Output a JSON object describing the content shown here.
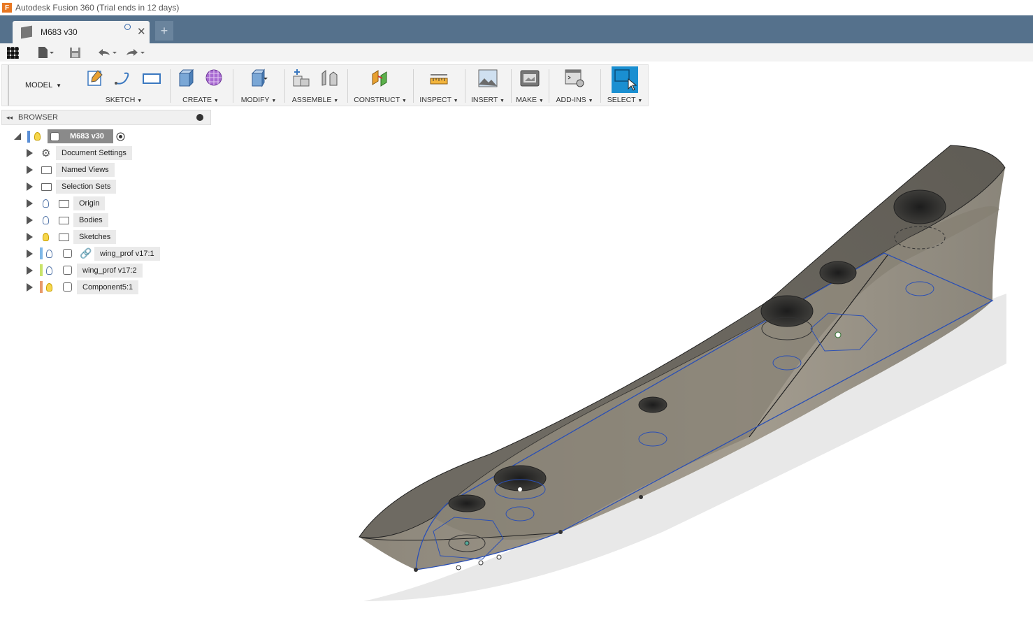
{
  "window": {
    "title": "Autodesk Fusion 360 (Trial ends in 12 days)",
    "app_icon": "F"
  },
  "tabs": {
    "doc_title": "M683 v30",
    "new_tab": "+",
    "close": "✕"
  },
  "toolbar": {
    "workspace": "MODEL",
    "groups": [
      {
        "label": "SKETCH"
      },
      {
        "label": "CREATE"
      },
      {
        "label": "MODIFY"
      },
      {
        "label": "ASSEMBLE"
      },
      {
        "label": "CONSTRUCT"
      },
      {
        "label": "INSPECT"
      },
      {
        "label": "INSERT"
      },
      {
        "label": "MAKE"
      },
      {
        "label": "ADD-INS"
      },
      {
        "label": "SELECT"
      }
    ],
    "dropdown_caret": "▼"
  },
  "browser": {
    "title": "BROWSER",
    "root": "M683 v30",
    "items": [
      {
        "label": "Document Settings"
      },
      {
        "label": "Named Views"
      },
      {
        "label": "Selection Sets"
      },
      {
        "label": "Origin"
      },
      {
        "label": "Bodies"
      },
      {
        "label": "Sketches"
      },
      {
        "label": "wing_prof v17:1"
      },
      {
        "label": "wing_prof v17:2"
      },
      {
        "label": "Component5:1"
      }
    ]
  },
  "colors": {
    "tabbar": "#55718c",
    "select_active": "#1a8fd1",
    "sketch_line": "#2a4fb5"
  }
}
